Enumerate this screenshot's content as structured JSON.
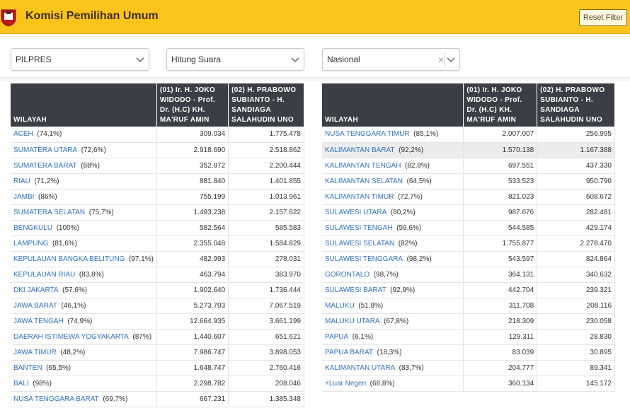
{
  "header": {
    "title": "Komisi Pemilihan Umum",
    "reset_label": "Reset Filter",
    "colors": {
      "bar": "#fbc41a",
      "link": "#2f72c4",
      "table_header": "#3b3f45"
    },
    "logo_icon": "kpu-logo-icon"
  },
  "filters": [
    {
      "value": "PILPRES"
    },
    {
      "value": "Hitung Suara"
    },
    {
      "value": "Nasional",
      "clear": "×"
    }
  ],
  "columns": {
    "wilayah": "WILAYAH",
    "cand1": "(01) Ir. H. JOKO WIDODO - Prof. Dr. (H.C) KH. MA'RUF AMIN",
    "cand2": "(02) H. PRABOWO SUBIANTO - H. SANDIAGA SALAHUDIN UNO"
  },
  "left_rows": [
    {
      "name": "ACEH",
      "pct": "(74,1%)",
      "v1": "309.034",
      "v2": "1.775.478"
    },
    {
      "name": "SUMATERA UTARA",
      "pct": "(72,6%)",
      "v1": "2.918.690",
      "v2": "2.518.862"
    },
    {
      "name": "SUMATERA BARAT",
      "pct": "(88%)",
      "v1": "352.872",
      "v2": "2.200.444"
    },
    {
      "name": "RIAU",
      "pct": "(71,2%)",
      "v1": "881.840",
      "v2": "1.401.855"
    },
    {
      "name": "JAMBI",
      "pct": "(86%)",
      "v1": "755.199",
      "v2": "1.013.961"
    },
    {
      "name": "SUMATERA SELATAN",
      "pct": "(75,7%)",
      "v1": "1.493.238",
      "v2": "2.157.622"
    },
    {
      "name": "BENGKULU",
      "pct": "(100%)",
      "v1": "582.564",
      "v2": "585.583"
    },
    {
      "name": "LAMPUNG",
      "pct": "(81,6%)",
      "v1": "2.355.048",
      "v2": "1.584.829"
    },
    {
      "name": "KEPULAUAN BANGKA BELITUNG",
      "pct": "(97,1%)",
      "v1": "482.993",
      "v2": "278.031"
    },
    {
      "name": "KEPULAUAN RIAU",
      "pct": "(83,8%)",
      "v1": "463.794",
      "v2": "383.970"
    },
    {
      "name": "DKI JAKARTA",
      "pct": "(57,6%)",
      "v1": "1.902.640",
      "v2": "1.736.444"
    },
    {
      "name": "JAWA BARAT",
      "pct": "(46,1%)",
      "v1": "5.273.703",
      "v2": "7.067.519"
    },
    {
      "name": "JAWA TENGAH",
      "pct": "(74,9%)",
      "v1": "12.664.935",
      "v2": "3.661.199"
    },
    {
      "name": "DAERAH ISTIMEWA YOGYAKARTA",
      "pct": "(87%)",
      "v1": "1.440.607",
      "v2": "651.621"
    },
    {
      "name": "JAWA TIMUR",
      "pct": "(48,2%)",
      "v1": "7.986.747",
      "v2": "3.898.053"
    },
    {
      "name": "BANTEN",
      "pct": "(65,5%)",
      "v1": "1.648.747",
      "v2": "2.760.416"
    },
    {
      "name": "BALI",
      "pct": "(98%)",
      "v1": "2.298.782",
      "v2": "208.046"
    },
    {
      "name": "NUSA TENGGARA BARAT",
      "pct": "(69,7%)",
      "v1": "667.231",
      "v2": "1.385.348"
    }
  ],
  "right_rows": [
    {
      "name": "NUSA TENGGARA TIMUR",
      "pct": "(85,1%)",
      "v1": "2.007.007",
      "v2": "256.995"
    },
    {
      "name": "KALIMANTAN BARAT",
      "pct": "(92,2%)",
      "v1": "1.570.138",
      "v2": "1.167.388",
      "highlight": true
    },
    {
      "name": "KALIMANTAN TENGAH",
      "pct": "(82,8%)",
      "v1": "697.551",
      "v2": "437.330"
    },
    {
      "name": "KALIMANTAN SELATAN",
      "pct": "(64,5%)",
      "v1": "533.523",
      "v2": "950.790"
    },
    {
      "name": "KALIMANTAN TIMUR",
      "pct": "(72,7%)",
      "v1": "821.023",
      "v2": "608.672"
    },
    {
      "name": "SULAWESI UTARA",
      "pct": "(80,2%)",
      "v1": "987.676",
      "v2": "282.481"
    },
    {
      "name": "SULAWESI TENGAH",
      "pct": "(59,6%)",
      "v1": "544.585",
      "v2": "429.174"
    },
    {
      "name": "SULAWESI SELATAN",
      "pct": "(82%)",
      "v1": "1.755.877",
      "v2": "2.278.470"
    },
    {
      "name": "SULAWESI TENGGARA",
      "pct": "(98,2%)",
      "v1": "543.597",
      "v2": "824.864"
    },
    {
      "name": "GORONTALO",
      "pct": "(98,7%)",
      "v1": "364.131",
      "v2": "340.632"
    },
    {
      "name": "SULAWESI BARAT",
      "pct": "(92,9%)",
      "v1": "442.704",
      "v2": "239.321"
    },
    {
      "name": "MALUKU",
      "pct": "(51,8%)",
      "v1": "311.708",
      "v2": "208.116"
    },
    {
      "name": "MALUKU UTARA",
      "pct": "(67,8%)",
      "v1": "218.309",
      "v2": "230.058"
    },
    {
      "name": "PAPUA",
      "pct": "(6,1%)",
      "v1": "129.311",
      "v2": "28.830"
    },
    {
      "name": "PAPUA BARAT",
      "pct": "(18,3%)",
      "v1": "83.039",
      "v2": "30.895"
    },
    {
      "name": "KALIMANTAN UTARA",
      "pct": "(83,7%)",
      "v1": "204.777",
      "v2": "89.341"
    },
    {
      "name": "+Luar Negeri",
      "pct": "(68,8%)",
      "v1": "360.134",
      "v2": "145.172"
    }
  ]
}
